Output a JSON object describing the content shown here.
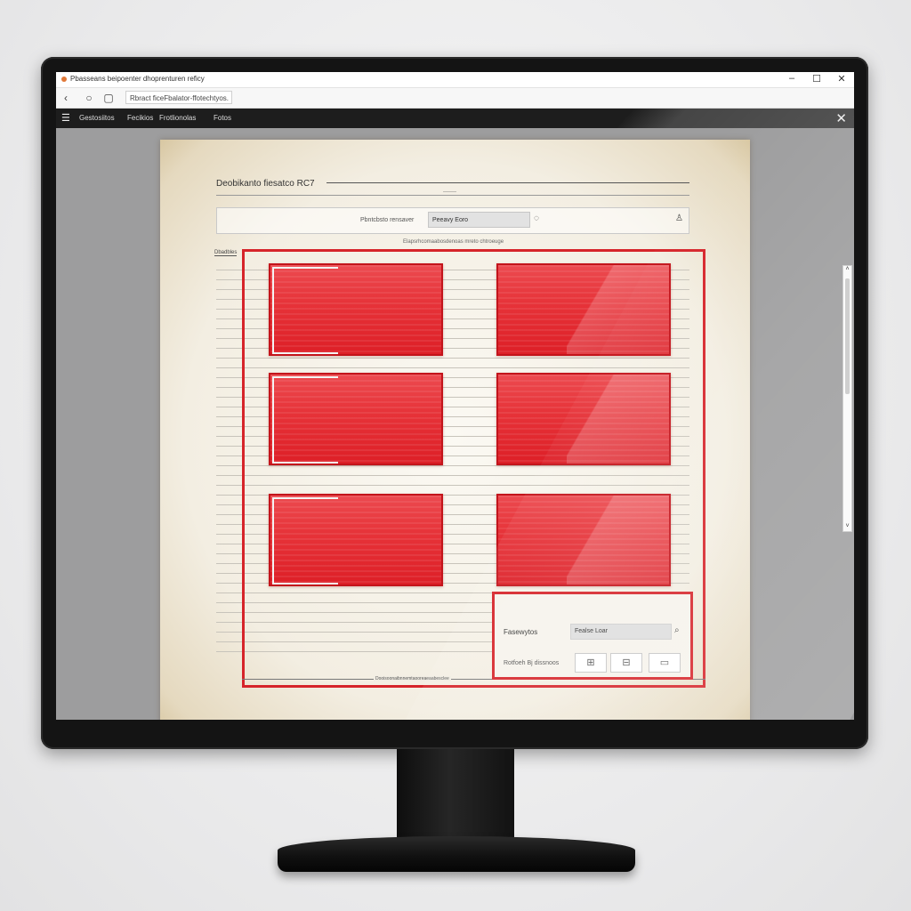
{
  "window": {
    "title": "Pbasseans beipoenter dhoprenturen reficy",
    "minimize_label": "–",
    "maximize_label": "☐",
    "close_label": "✕"
  },
  "address_bar": {
    "back_icon": "‹",
    "reload_icon": "○",
    "page_icon": "▢",
    "url": "Rbract ficeFbalator-ffotechtyos."
  },
  "menu_bar": {
    "hamburger_icon": "☰",
    "items": [
      "Gestosiitos",
      "Fecikios",
      "Frotlionolas",
      "Fotos"
    ],
    "close_icon": "✕"
  },
  "document": {
    "title": "Deobikanto fiesatco RC7",
    "sub_rule_text": "———",
    "toolbar": {
      "label": "Pbntcbsto rensaver",
      "input_value": "Peeavy Eoro",
      "circle_icon": "◌",
      "person_icon": "♙"
    },
    "grid_caption": "Elapsrhcomaabosdenoas mreto chtroeuge",
    "side_label": "Dbadbles",
    "footer_text": "Dooisoonaibnnemtaooreaeaabesclee"
  },
  "search_panel": {
    "label": "Fasewytos",
    "input_value": "Fealse Loar",
    "search_icon": "⌕",
    "hint": "Rotfoeh Bj dissnoos",
    "buttons": [
      {
        "name": "table-view-button",
        "icon": "⊞"
      },
      {
        "name": "folder-button",
        "icon": "⊟"
      },
      {
        "name": "rectangle-button",
        "icon": "▭"
      }
    ]
  },
  "scrollbar": {
    "up_arrow": "˄",
    "down_arrow": "˅"
  },
  "colors": {
    "accent_red": "#d6242a",
    "card_red": "#e63238",
    "menu_bar": "#1d1d1d",
    "paper": "#f3eee2"
  }
}
